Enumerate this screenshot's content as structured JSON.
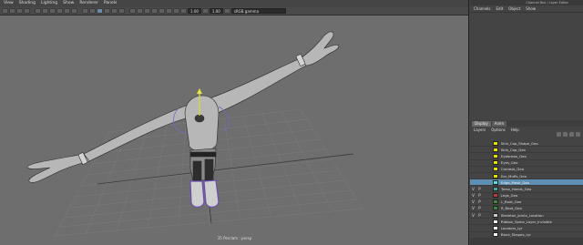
{
  "viewport": {
    "menu": [
      "View",
      "Shading",
      "Lighting",
      "Show",
      "Renderer",
      "Panels"
    ],
    "toolbar": {
      "field_a": "1.00",
      "field_b": "1.00",
      "color_space": "sRGB gamma"
    },
    "camera_label": "35 Perclam : persp"
  },
  "panel": {
    "title": "Channel Box / Layer Editor",
    "channel_box_menu": [
      "Channels",
      "Edit",
      "Object",
      "Show"
    ],
    "layer_editor": {
      "tabs": [
        "Display",
        "Anim"
      ],
      "menu": [
        "Layers",
        "Options",
        "Help"
      ],
      "layers": [
        {
          "visible": "",
          "playback": "",
          "color": "#e6e000",
          "name": "Skin_Cap_Shape_Geo"
        },
        {
          "visible": "",
          "playback": "",
          "color": "#e6e000",
          "name": "Skin_Cap_Geo"
        },
        {
          "visible": "",
          "playback": "",
          "color": "#e6e000",
          "name": "Eyebrows_Geo"
        },
        {
          "visible": "",
          "playback": "",
          "color": "#e6e000",
          "name": "Eyes_Geo"
        },
        {
          "visible": "",
          "playback": "",
          "color": "#e6e000",
          "name": "Corneas_Geo"
        },
        {
          "visible": "",
          "playback": "",
          "color": "#e6e000",
          "name": "Ear_Muffs_Geo"
        },
        {
          "visible": "",
          "playback": "",
          "color": "#5fe0d8",
          "name": "Edge_Mesh_Geo",
          "selected": true
        },
        {
          "visible": "V",
          "playback": "P",
          "color": "#40a8a0",
          "name": "Torso_Hands_Geo"
        },
        {
          "visible": "V",
          "playback": "P",
          "color": "#b04040",
          "name": "Legs_Geo"
        },
        {
          "visible": "V",
          "playback": "P",
          "color": "#3a8a3a",
          "name": "L_Boot_Geo"
        },
        {
          "visible": "V",
          "playback": "P",
          "color": "#3a8a3a",
          "name": "R_Boot_Geo"
        },
        {
          "visible": "V",
          "playback": "P",
          "color": "#c8c8c8",
          "name": "Skeleton_Joints_Location"
        },
        {
          "visible": "",
          "playback": "",
          "color": "#ffffff",
          "name": "Ribbon_Spine_Layer_Invisible"
        },
        {
          "visible": "",
          "playback": "",
          "color": "#ffffff",
          "name": "Locators_Lyr"
        },
        {
          "visible": "",
          "playback": "",
          "color": "#ffffff",
          "name": "Bone_Shapes_Lyr"
        }
      ]
    }
  }
}
